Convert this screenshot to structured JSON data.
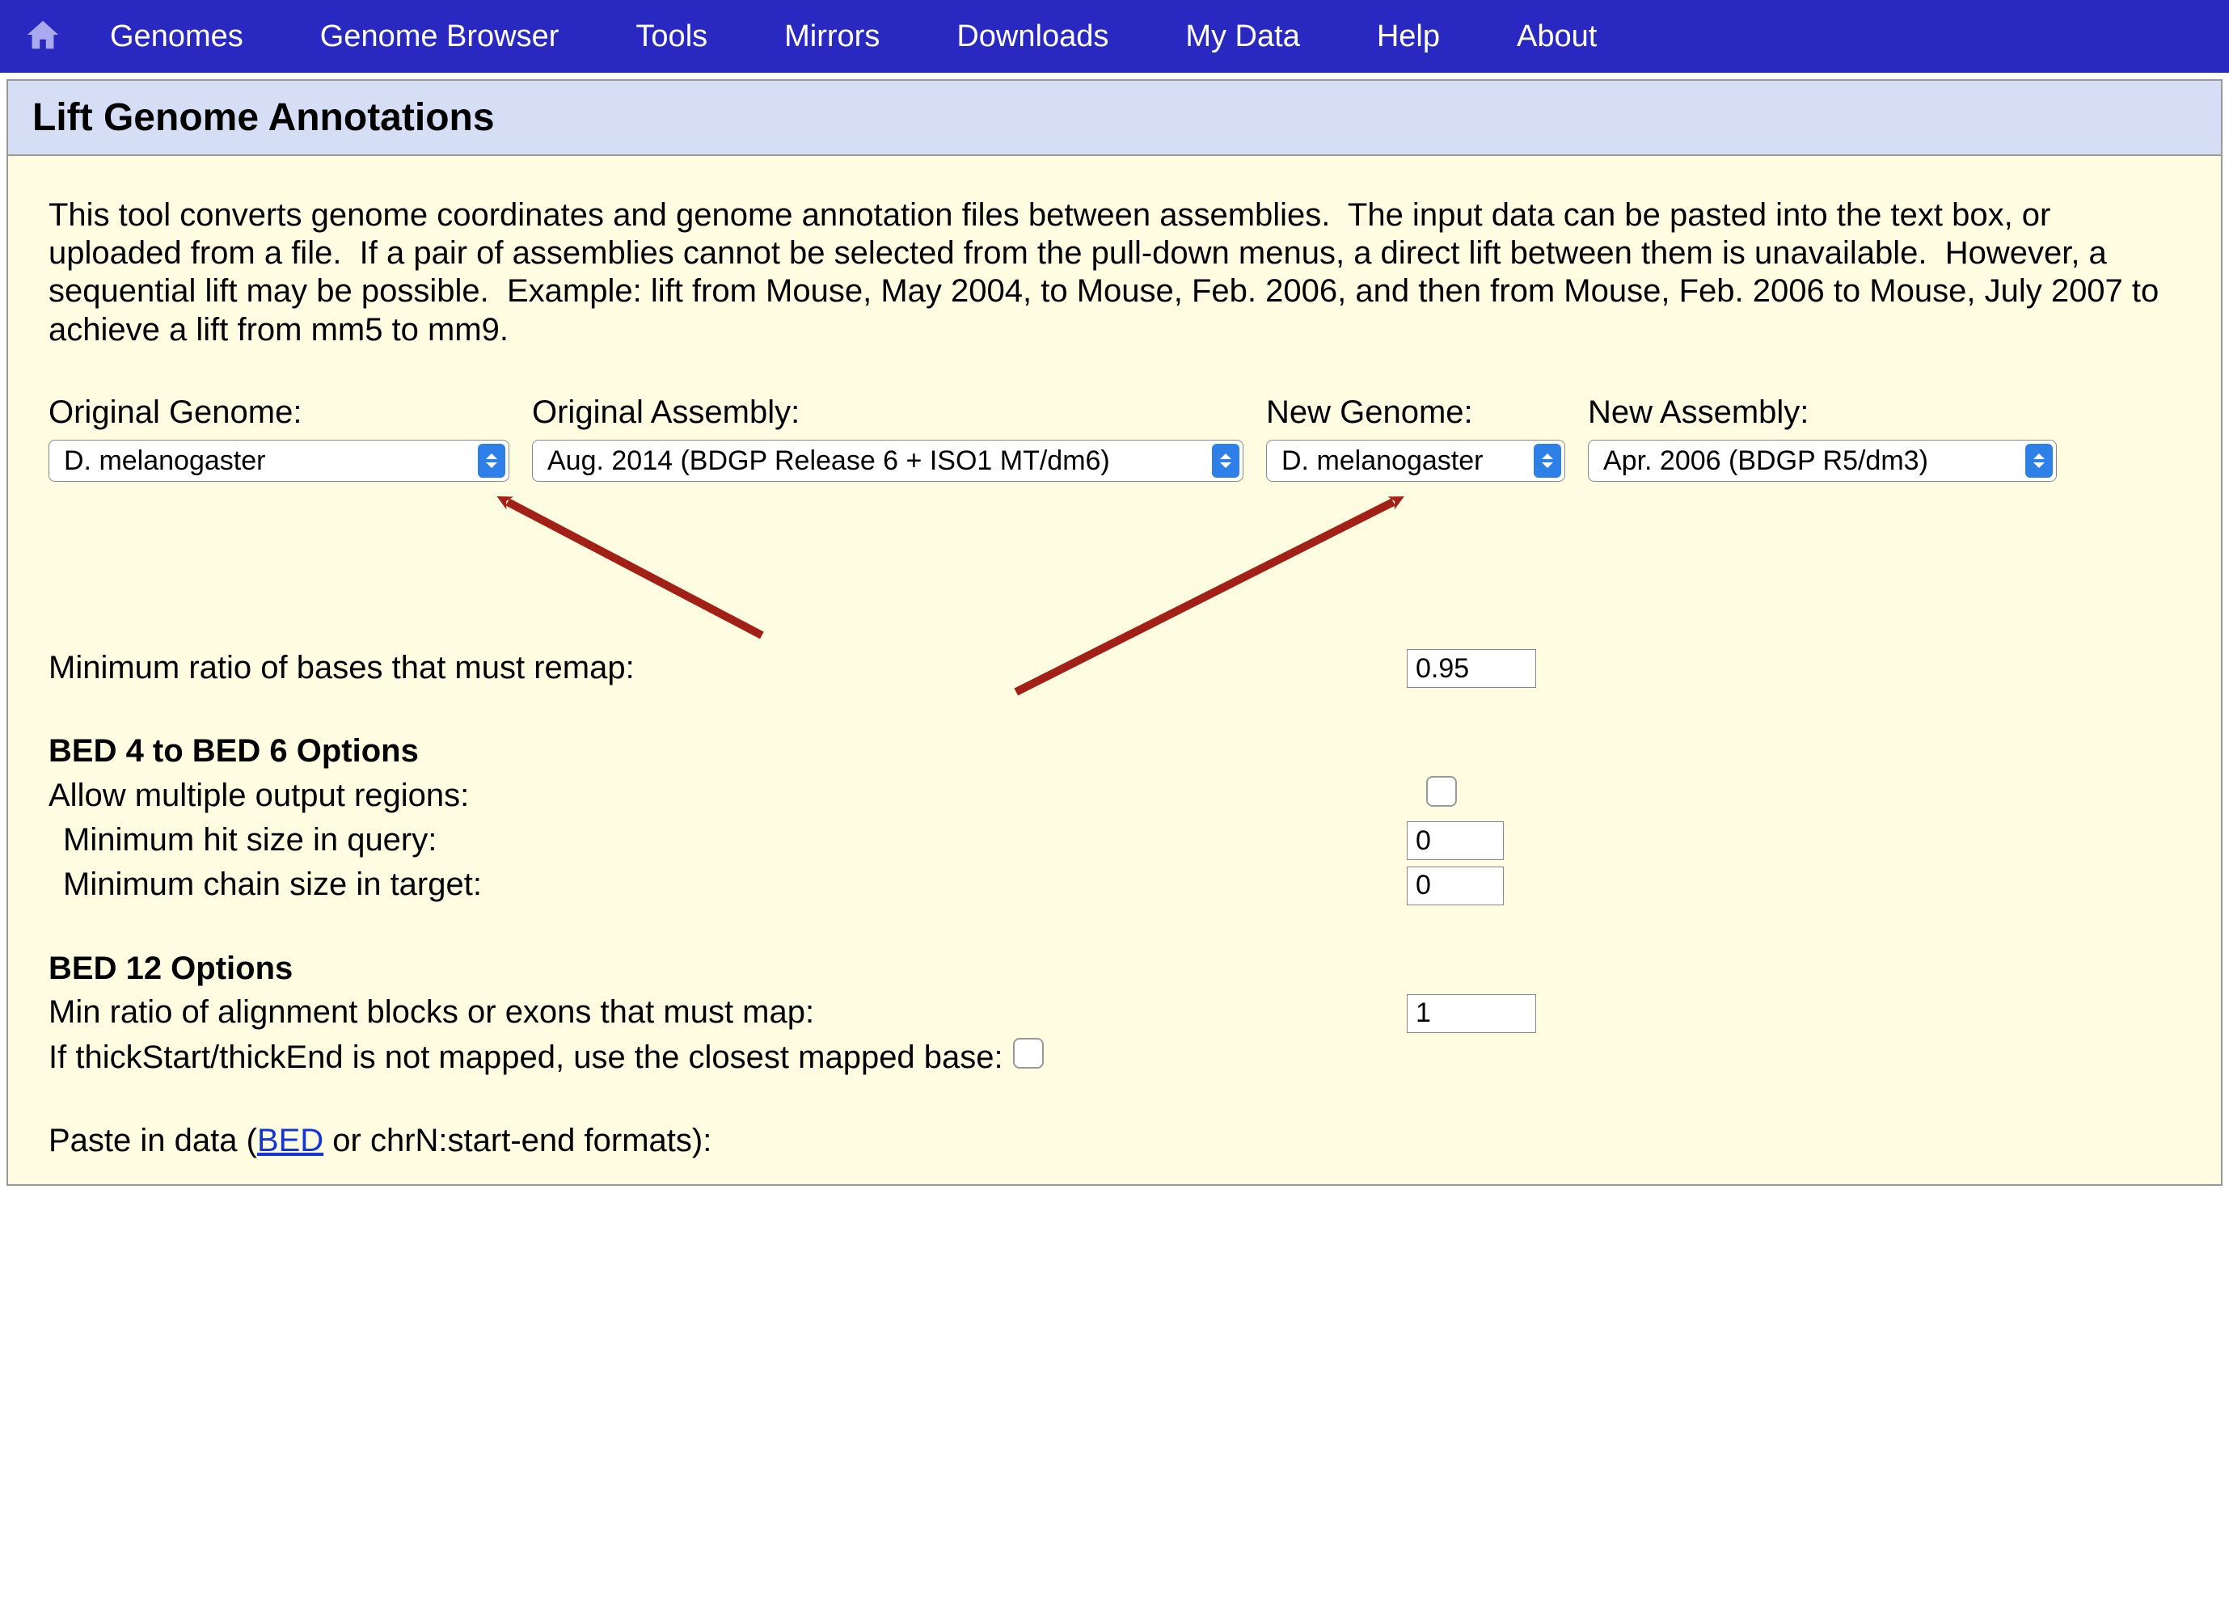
{
  "nav": {
    "items": [
      "Genomes",
      "Genome Browser",
      "Tools",
      "Mirrors",
      "Downloads",
      "My Data",
      "Help",
      "About"
    ]
  },
  "page": {
    "title": "Lift Genome Annotations",
    "intro": "This tool converts genome coordinates and genome annotation files between assemblies.  The input data can be pasted into the text box, or uploaded from a file.  If a pair of assemblies cannot be selected from the pull-down menus, a direct lift between them is unavailable.  However, a sequential lift may be possible.  Example: lift from Mouse, May 2004, to Mouse, Feb. 2006, and then from Mouse, Feb. 2006 to Mouse, July 2007 to achieve a lift from mm5 to mm9."
  },
  "selectors": {
    "original_genome": {
      "label": "Original Genome:",
      "value": "D. melanogaster"
    },
    "original_assembly": {
      "label": "Original Assembly:",
      "value": "Aug. 2014 (BDGP Release 6 + ISO1 MT/dm6)"
    },
    "new_genome": {
      "label": "New Genome:",
      "value": "D. melanogaster"
    },
    "new_assembly": {
      "label": "New Assembly:",
      "value": "Apr. 2006 (BDGP R5/dm3)"
    }
  },
  "form": {
    "min_ratio": {
      "label": "Minimum ratio of bases that must remap:",
      "value": "0.95"
    },
    "bed46_heading": "BED 4 to BED 6 Options",
    "allow_multiple": {
      "label": "Allow multiple output regions:",
      "checked": false
    },
    "min_hit_query": {
      "label": "Minimum hit size in query:",
      "value": "0"
    },
    "min_chain_target": {
      "label": "Minimum chain size in target:",
      "value": "0"
    },
    "bed12_heading": "BED 12 Options",
    "min_block_ratio": {
      "label": "Min ratio of alignment blocks or exons that must map:",
      "value": "1"
    },
    "thick_fallback": {
      "label": "If thickStart/thickEnd is not mapped, use the closest mapped base:",
      "checked": false
    },
    "paste_prefix": "Paste in data (",
    "paste_link": "BED",
    "paste_suffix": " or chrN:start-end formats):"
  }
}
